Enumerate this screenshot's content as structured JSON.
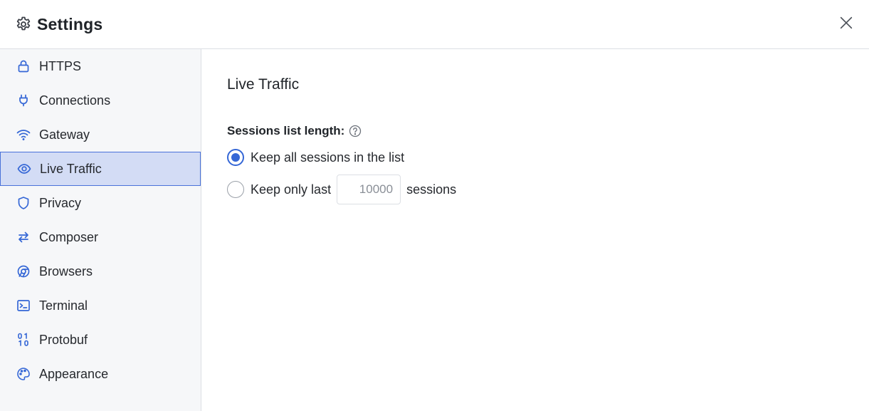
{
  "header": {
    "title": "Settings",
    "gear_icon": "gear-icon",
    "close_icon": "close-icon"
  },
  "sidebar": {
    "items": [
      {
        "label": "HTTPS",
        "icon": "lock-icon"
      },
      {
        "label": "Connections",
        "icon": "plug-icon"
      },
      {
        "label": "Gateway",
        "icon": "wifi-icon"
      },
      {
        "label": "Live Traffic",
        "icon": "eye-icon",
        "active": true
      },
      {
        "label": "Privacy",
        "icon": "shield-icon"
      },
      {
        "label": "Composer",
        "icon": "arrows-exchange-icon"
      },
      {
        "label": "Browsers",
        "icon": "browser-icon"
      },
      {
        "label": "Terminal",
        "icon": "terminal-icon"
      },
      {
        "label": "Protobuf",
        "icon": "binary-icon"
      },
      {
        "label": "Appearance",
        "icon": "palette-icon"
      }
    ]
  },
  "main": {
    "section_title": "Live Traffic",
    "sessions_label": "Sessions list length:",
    "help_icon": "question-circle-icon",
    "option_all": "Keep all sessions in the list",
    "option_last_prefix": "Keep only last",
    "option_last_suffix": "sessions",
    "last_count_placeholder": "10000",
    "selected_option": "all"
  },
  "colors": {
    "accent": "#3567d6",
    "active_bg": "#d3dcf5",
    "sidebar_bg": "#f6f7f9",
    "border": "#dcdfe4"
  }
}
